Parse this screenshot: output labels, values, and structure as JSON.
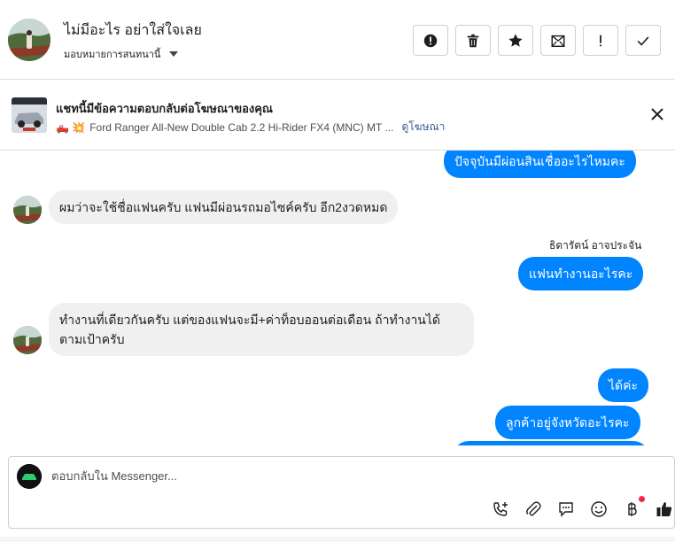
{
  "header": {
    "name": "ไม่มีอะไร อย่าใส่ใจเลย",
    "assign_label": "มอบหมายการสนทนานี้",
    "actions": [
      {
        "icon": "alert-circle-icon",
        "label": "Mark as spam"
      },
      {
        "icon": "trash-icon",
        "label": "Delete"
      },
      {
        "icon": "star-icon",
        "label": "Star"
      },
      {
        "icon": "mail-open-icon",
        "label": "Mark unread"
      },
      {
        "icon": "exclamation-icon",
        "label": "Follow up"
      },
      {
        "icon": "check-icon",
        "label": "Done"
      }
    ]
  },
  "ad": {
    "title": "แชทนี้มีข้อความตอบกลับต่อโฆษณาของคุณ",
    "emoji": "🛻 💥",
    "description": "Ford Ranger All-New Double Cab 2.2 Hi-Rider FX4 (MNC) MT ...",
    "link": "ดูโฆษณา"
  },
  "messages": [
    {
      "dir": "out",
      "text": "ปัจจุบันมีผ่อนสินเชื่ออะไรไหมคะ"
    },
    {
      "dir": "in",
      "text": "ผมว่าจะใช้ชื่อแฟนครับ แฟนมีผ่อนรถมอไซค์ครับ อีก2งวดหมด"
    },
    {
      "dir": "sender",
      "text": "ธิดารัตน์ อาจประจัน"
    },
    {
      "dir": "out",
      "text": "แฟนทำงานอะไรคะ"
    },
    {
      "dir": "in",
      "text": "ทำงานที่เดียวกันครับ แต่ของแฟนจะมี+ค่าท็อบออนต่อเดือน ถ้าทำงานได้ตามเป้าครับ"
    },
    {
      "dir": "out",
      "text": "ได้ค่ะ"
    },
    {
      "dir": "out",
      "text": "ลูกค้าอยู่จังหวัดอะไรคะ"
    }
  ],
  "composer": {
    "placeholder": "ตอบกลับใน Messenger...",
    "tools": [
      "phone-add-icon",
      "paperclip-icon",
      "chat-bubble-icon",
      "smiley-icon",
      "baht-icon",
      "thumbs-up-icon"
    ]
  },
  "colors": {
    "outgoing_bubble": "#0084ff",
    "incoming_bubble": "#f1f0f0",
    "link": "#385898",
    "notification_dot": "#f02849"
  }
}
